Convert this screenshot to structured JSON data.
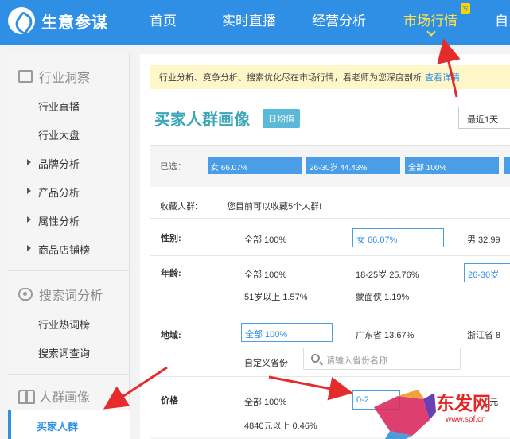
{
  "brand": {
    "name": "生意参谋"
  },
  "nav": {
    "items": [
      "首页",
      "实时直播",
      "经营分析",
      "市场行情",
      "自"
    ],
    "badge": "专"
  },
  "sidebar": {
    "sections": [
      {
        "title": "行业洞察",
        "icon": "monitor-icon",
        "items": [
          "行业直播",
          "行业大盘",
          "品牌分析",
          "产品分析",
          "属性分析",
          "商品店铺榜"
        ]
      },
      {
        "title": "搜索词分析",
        "icon": "eye-icon",
        "items": [
          "行业热词榜",
          "搜索词查询"
        ]
      },
      {
        "title": "人群画像",
        "icon": "people-icon",
        "items": [
          "买家人群"
        ]
      }
    ]
  },
  "notice": {
    "text": "行业分析、竞争分析、搜索优化尽在市场行情，看老师为您深度剖析",
    "link": "查看详情"
  },
  "page": {
    "title": "买家人群画像",
    "tag": "日均值",
    "date_range": "最近1天"
  },
  "selected": {
    "label": "已选：",
    "chips": [
      "女 66.07%",
      "26-30岁 44.43%",
      "全部 100%"
    ]
  },
  "favorites": {
    "label": "收藏人群:",
    "text": "您目前可以收藏5个人群!"
  },
  "gender": {
    "label": "性别:",
    "options": [
      "全部 100%",
      "女 66.07%",
      "男 32.99"
    ]
  },
  "age": {
    "label": "年龄:",
    "options": [
      "全部 100%",
      "18-25岁 25.76%",
      "26-30岁",
      "51岁以上 1.57%",
      "蒙面侠 1.19%"
    ]
  },
  "region": {
    "label": "地域:",
    "options": [
      "全部 100%",
      "广东省 13.67%",
      "浙江省 8"
    ],
    "custom_label": "自定义省份",
    "search_placeholder": "请输入省份名称"
  },
  "price": {
    "label": "价格",
    "options": [
      "全部 100%",
      "0-2",
      "4840元以上 0.46%",
      "0元"
    ]
  },
  "watermark": {
    "title": "东发网",
    "url": "www.spf.cn"
  }
}
